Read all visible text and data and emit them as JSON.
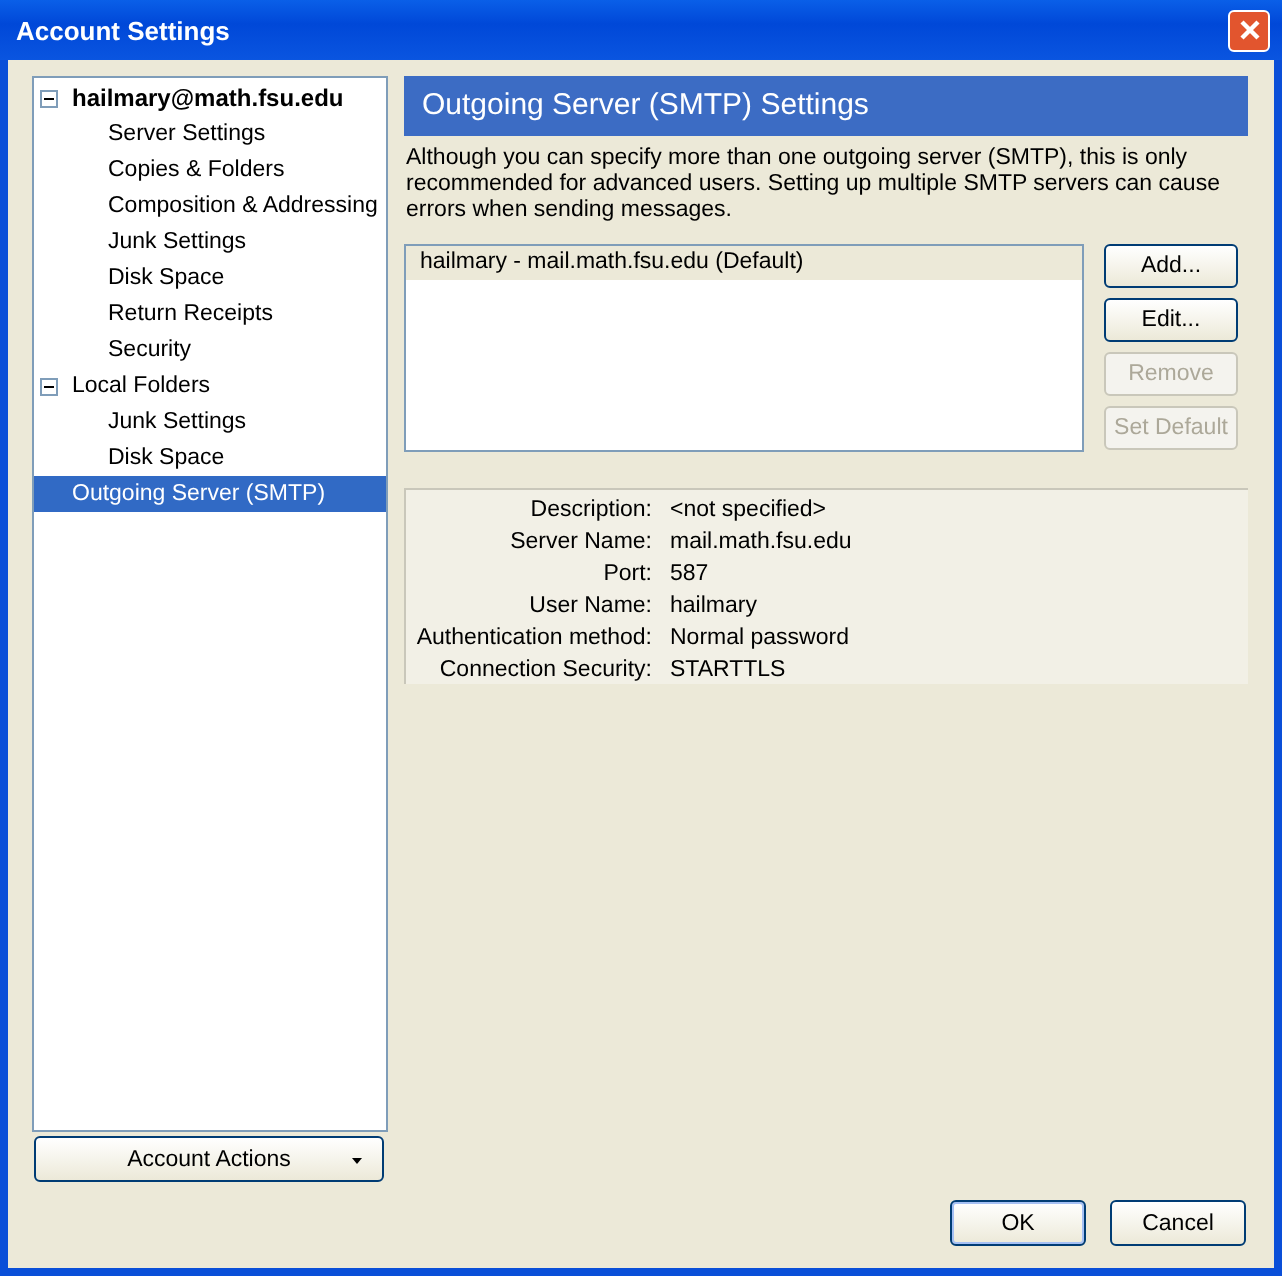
{
  "window": {
    "title": "Account Settings"
  },
  "sidebar": {
    "tree": [
      {
        "label": "hailmary@math.fsu.edu",
        "kind": "account",
        "expanded": true,
        "selected": false,
        "children": [
          {
            "label": "Server Settings",
            "selected": false
          },
          {
            "label": "Copies & Folders",
            "selected": false
          },
          {
            "label": "Composition & Addressing",
            "selected": false
          },
          {
            "label": "Junk Settings",
            "selected": false
          },
          {
            "label": "Disk Space",
            "selected": false
          },
          {
            "label": "Return Receipts",
            "selected": false
          },
          {
            "label": "Security",
            "selected": false
          }
        ]
      },
      {
        "label": "Local Folders",
        "kind": "folder",
        "expanded": true,
        "selected": false,
        "children": [
          {
            "label": "Junk Settings",
            "selected": false
          },
          {
            "label": "Disk Space",
            "selected": false
          }
        ]
      },
      {
        "label": "Outgoing Server (SMTP)",
        "kind": "folder",
        "selected": true
      }
    ],
    "actions_button": "Account Actions"
  },
  "panel": {
    "title": "Outgoing Server (SMTP) Settings",
    "description": "Although you can specify more than one outgoing server (SMTP), this is only recommended for advanced users. Setting up multiple SMTP servers can cause errors when sending messages.",
    "servers": [
      {
        "label": "hailmary - mail.math.fsu.edu (Default)",
        "selected": true
      }
    ],
    "buttons": [
      {
        "label": "Add...",
        "disabled": false
      },
      {
        "label": "Edit...",
        "disabled": false
      },
      {
        "label": "Remove",
        "disabled": true
      },
      {
        "label": "Set Default",
        "disabled": true
      }
    ],
    "details": [
      {
        "label": "Description:",
        "value": "<not specified>"
      },
      {
        "label": "Server Name:",
        "value": "mail.math.fsu.edu"
      },
      {
        "label": "Port:",
        "value": "587"
      },
      {
        "label": "User Name:",
        "value": "hailmary"
      },
      {
        "label": "Authentication method:",
        "value": "Normal password"
      },
      {
        "label": "Connection Security:",
        "value": "STARTTLS"
      }
    ]
  },
  "footer": {
    "buttons": [
      {
        "label": "OK",
        "default": true
      },
      {
        "label": "Cancel",
        "default": false
      }
    ]
  }
}
